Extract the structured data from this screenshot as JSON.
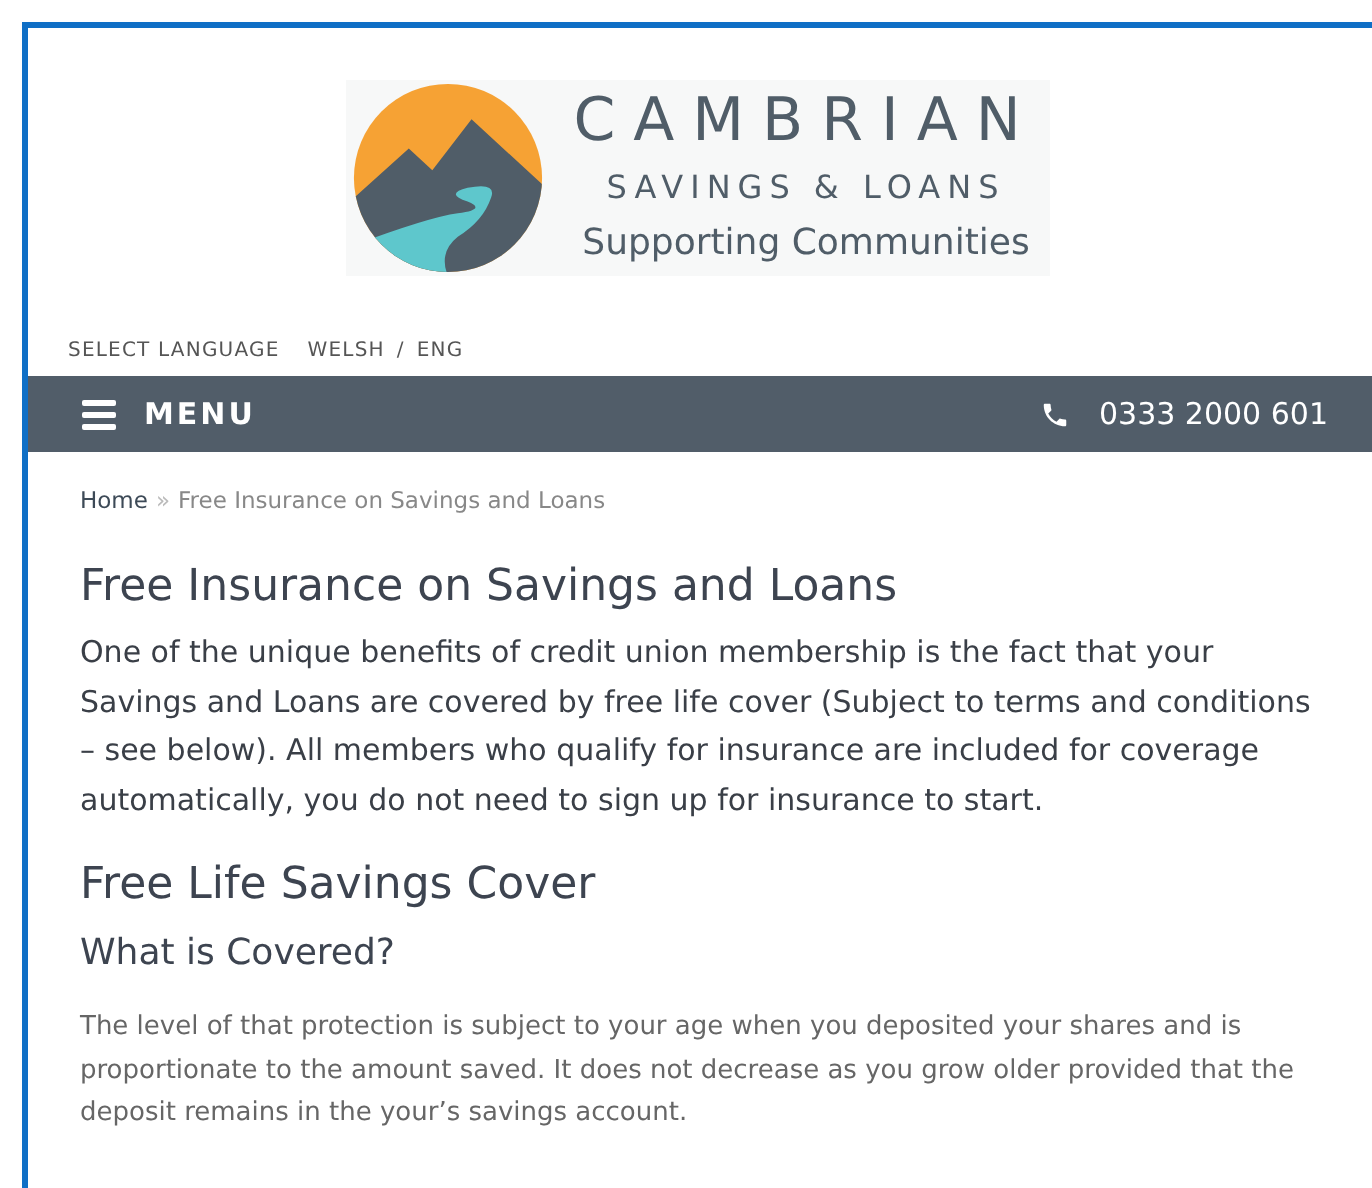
{
  "logo": {
    "name": "CAMBRIAN",
    "subtitle": "SAVINGS & LOANS",
    "tagline": "Supporting Communities"
  },
  "language": {
    "label": "SELECT LANGUAGE",
    "options": [
      "WELSH",
      "ENG"
    ],
    "separator": "/"
  },
  "nav": {
    "menu": "MENU",
    "phone": "0333 2000 601"
  },
  "breadcrumb": {
    "home": "Home",
    "separator": "»",
    "current": "Free Insurance on Savings and Loans"
  },
  "content": [
    {
      "kind": "h1",
      "text": "Free Insurance on Savings and Loans"
    },
    {
      "kind": "lead",
      "text": "One of the unique benefits of credit union membership is the fact that your Savings and Loans are covered by free life cover (Subject to terms and conditions – see below). All members who qualify for insurance are included for coverage automatically, you do not need to sign up for insurance to start."
    },
    {
      "kind": "h1",
      "text": "Free Life Savings Cover"
    },
    {
      "kind": "h2",
      "text": "What is Covered?"
    },
    {
      "kind": "p",
      "text": "The level of that protection is subject to your age when you deposited your shares and is proportionate to the amount saved.  It does not decrease as you grow older provided that the deposit remains in the your’s savings account."
    }
  ]
}
